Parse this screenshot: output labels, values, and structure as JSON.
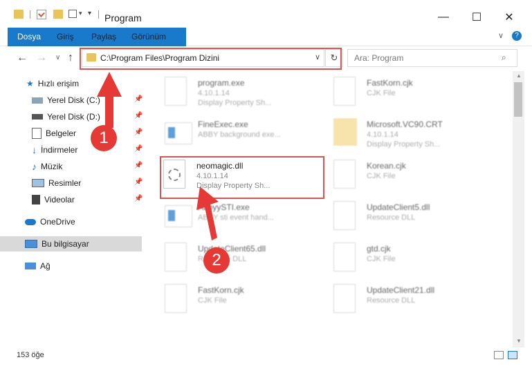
{
  "window": {
    "title": "Program",
    "minimize": "—",
    "maximize": "☐",
    "close": "✕"
  },
  "ribbon": {
    "tabs": [
      "Dosya",
      "Giriş",
      "Paylaş",
      "Görünüm"
    ]
  },
  "address": {
    "path": "C:\\Program Files\\Program Dizini",
    "search_placeholder": "Ara: Program"
  },
  "sidebar": {
    "quick_access": "Hızlı erişim",
    "items": [
      "Yerel Disk (C:)",
      "Yerel Disk (D:)",
      "Belgeler",
      "İndirmeler",
      "Müzik",
      "Resimler",
      "Videolar"
    ],
    "onedrive": "OneDrive",
    "this_pc": "Bu bilgisayar",
    "network": "Ağ"
  },
  "files": [
    {
      "name": "program.exe",
      "line1": "4.10.1.14",
      "line2": "Display Property Sh..."
    },
    {
      "name": "FastKorn.cjk",
      "line1": "CJK File",
      "line2": ""
    },
    {
      "name": "FineExec.exe",
      "line1": "ABBY background exe...",
      "line2": ""
    },
    {
      "name": "Microsoft.VC90.CRT",
      "line1": "4.10.1.14",
      "line2": "Display Property Sh..."
    },
    {
      "name": "neomagic.dll",
      "line1": "4.10.1.14",
      "line2": "Display Property Sh..."
    },
    {
      "name": "Korean.cjk",
      "line1": "CJK File",
      "line2": ""
    },
    {
      "name": "AbbyySTI.exe",
      "line1": "ABBY sti event hand...",
      "line2": ""
    },
    {
      "name": "UpdateClient5.dll",
      "line1": "Resource DLL",
      "line2": ""
    },
    {
      "name": "UpdateClient65.dll",
      "line1": "Resource DLL",
      "line2": ""
    },
    {
      "name": "gtd.cjk",
      "line1": "CJK File",
      "line2": ""
    },
    {
      "name": "FastKorn.cjk",
      "line1": "CJK File",
      "line2": ""
    },
    {
      "name": "UpdateClient21.dll",
      "line1": "Resource DLL",
      "line2": ""
    }
  ],
  "status": {
    "count": "153 öğe"
  },
  "annotations": {
    "step1": "1",
    "step2": "2"
  },
  "colors": {
    "accent": "#1979ca",
    "highlight": "#d9534f",
    "selected": "#d9d9d9"
  }
}
